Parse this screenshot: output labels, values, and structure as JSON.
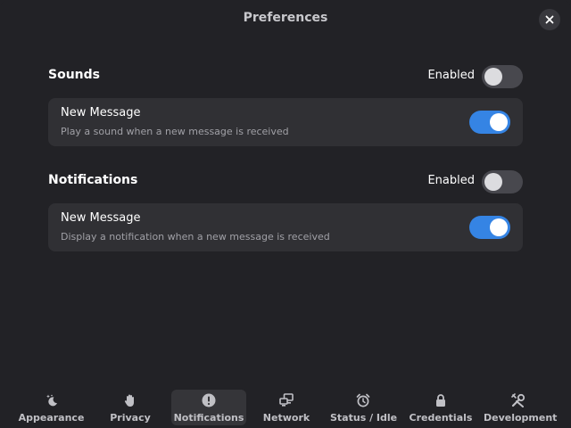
{
  "window": {
    "title": "Preferences",
    "close_icon": "close-icon"
  },
  "sections": [
    {
      "title": "Sounds",
      "toggle_label": "Enabled",
      "enabled": false,
      "rows": [
        {
          "title": "New Message",
          "subtitle": "Play a sound when a new message is received",
          "enabled": true
        }
      ]
    },
    {
      "title": "Notifications",
      "toggle_label": "Enabled",
      "enabled": false,
      "rows": [
        {
          "title": "New Message",
          "subtitle": "Display a notification when a new message is received",
          "enabled": true
        }
      ]
    }
  ],
  "nav": {
    "active": "Notifications",
    "items": [
      {
        "label": "Appearance",
        "icon": "weather-clear-night-icon"
      },
      {
        "label": "Privacy",
        "icon": "hand-icon"
      },
      {
        "label": "Notifications",
        "icon": "exclamation-circle-icon"
      },
      {
        "label": "Network",
        "icon": "network-computers-icon"
      },
      {
        "label": "Status / Idle",
        "icon": "alarm-clock-icon"
      },
      {
        "label": "Credentials",
        "icon": "lock-icon"
      },
      {
        "label": "Development",
        "icon": "tools-icon"
      }
    ]
  },
  "colors": {
    "background": "#222226",
    "card": "#303034",
    "accent": "#3584e4",
    "switch_off": "#48484e"
  }
}
